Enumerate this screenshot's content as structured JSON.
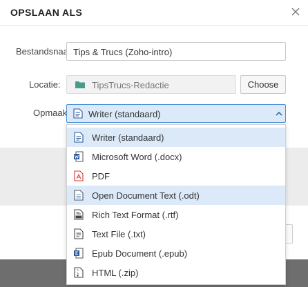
{
  "dialog": {
    "title": "OPSLAAN ALS",
    "close_icon": "close-icon"
  },
  "form": {
    "filename_label": "Bestandsnaam:",
    "filename_value": "Tips & Trucs (Zoho-intro)",
    "location_label": "Locatie:",
    "location_value": "TipsTrucs-Redactie",
    "location_icon": "folder-icon",
    "choose_label": "Choose",
    "format_label": "Opmaak:",
    "format_selected": "Writer (standaard)",
    "format_icon": "writer-doc-icon"
  },
  "format_menu": {
    "options": [
      {
        "label": "Writer (standaard)",
        "icon": "writer-doc-icon"
      },
      {
        "label": "Microsoft Word (.docx)",
        "icon": "word-doc-icon"
      },
      {
        "label": "PDF",
        "icon": "pdf-icon"
      },
      {
        "label": "Open Document Text (.odt)",
        "icon": "odt-icon"
      },
      {
        "label": "Rich Text Format (.rtf)",
        "icon": "rtf-icon"
      },
      {
        "label": "Text File (.txt)",
        "icon": "txt-icon"
      },
      {
        "label": "Epub Document (.epub)",
        "icon": "epub-icon"
      },
      {
        "label": "HTML (.zip)",
        "icon": "html-zip-icon"
      }
    ],
    "highlighted": [
      "Writer (standaard)",
      "Open Document Text (.odt)"
    ]
  },
  "colors": {
    "accent": "#4a90d9",
    "highlight": "#dbe9f8",
    "folder": "#4a9a8c",
    "pdf_red": "#d9342b",
    "word_blue": "#2b579a"
  }
}
